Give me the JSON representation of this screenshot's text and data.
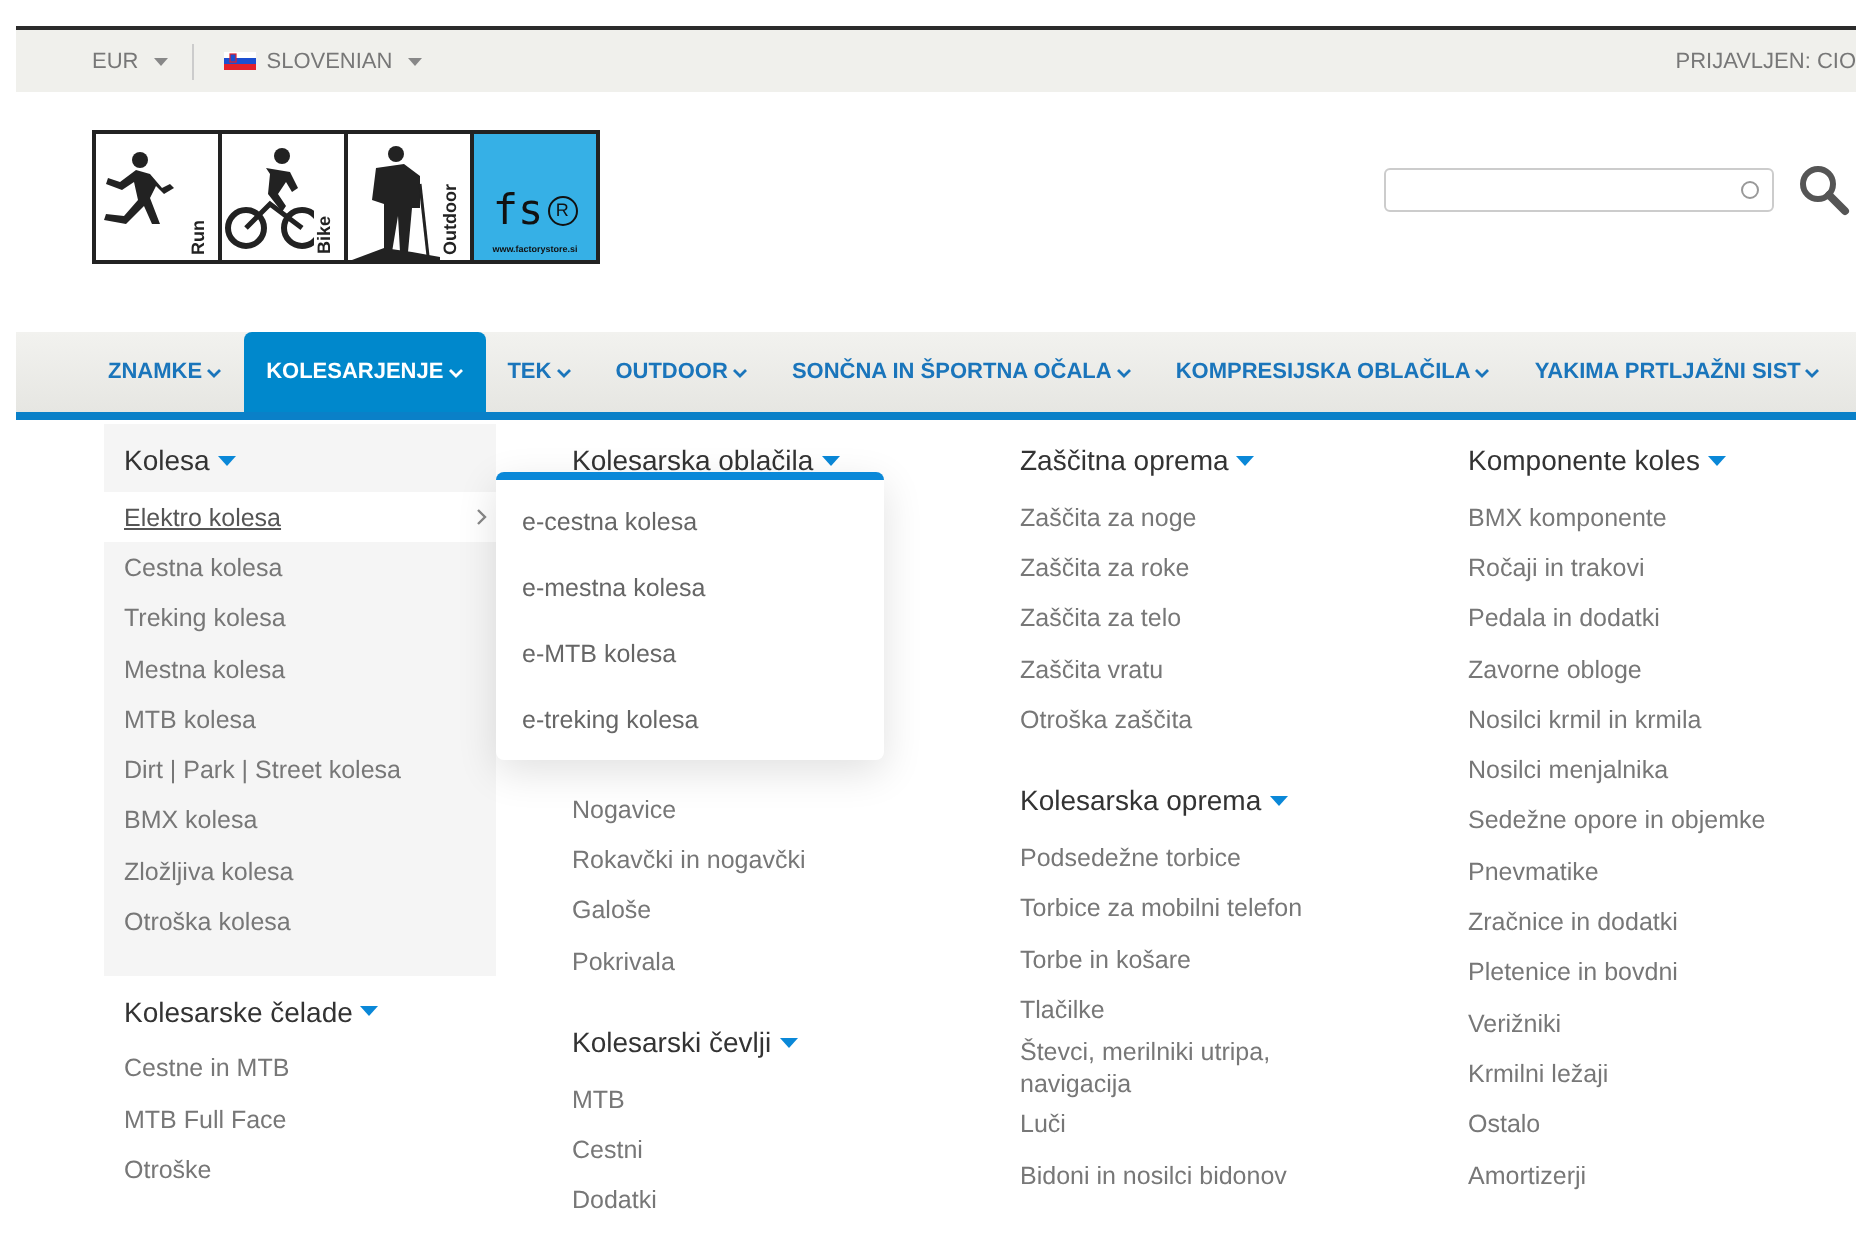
{
  "top_bar": {
    "currency": "EUR",
    "language": "SLOVENIAN",
    "login": "PRIJAVLJEN: CIO"
  },
  "logo": {
    "panels": [
      "Run",
      "Bike",
      "Outdoor"
    ],
    "mark": "fs",
    "mark_symbol": "R",
    "url": "www.factorystore.si"
  },
  "nav": [
    {
      "label": "ZNAMKE",
      "selected": false
    },
    {
      "label": "KOLESARJENJE",
      "selected": true
    },
    {
      "label": "TEK",
      "selected": false
    },
    {
      "label": "OUTDOOR",
      "selected": false
    },
    {
      "label": "SONČNA IN ŠPORTNA OČALA",
      "selected": false
    },
    {
      "label": "KOMPRESIJSKA OBLAČILA",
      "selected": false
    },
    {
      "label": "YAKIMA PRTLJAŽNI SIST",
      "selected": false
    }
  ],
  "mega_menu": {
    "columns": [
      {
        "groups": [
          {
            "heading": "Kolesa",
            "panel": true,
            "items": [
              {
                "label": "Elektro kolesa",
                "selected": true,
                "children": [
                  "e-cestna kolesa",
                  "e-mestna kolesa",
                  "e-MTB kolesa",
                  "e-treking kolesa"
                ]
              },
              {
                "label": "Cestna kolesa",
                "selected": false
              },
              {
                "label": "Treking kolesa",
                "selected": false
              },
              {
                "label": "Mestna kolesa",
                "selected": false
              },
              {
                "label": "MTB kolesa",
                "selected": false
              },
              {
                "label": "Dirt | Park | Street kolesa",
                "selected": false
              },
              {
                "label": "BMX kolesa",
                "selected": false
              },
              {
                "label": "Zložljiva kolesa",
                "selected": false
              },
              {
                "label": "Otroška kolesa",
                "selected": false
              }
            ]
          },
          {
            "heading": "Kolesarske čelade",
            "panel": false,
            "items": [
              {
                "label": "Cestne in MTB",
                "selected": false
              },
              {
                "label": "MTB Full Face",
                "selected": false
              },
              {
                "label": "Otroške",
                "selected": false
              }
            ]
          }
        ]
      },
      {
        "groups": [
          {
            "heading": "Kolesarska oblačila",
            "panel": false,
            "items": [
              {
                "label": "Nogavice",
                "selected": false
              },
              {
                "label": "Rokavčki in nogavčki",
                "selected": false
              },
              {
                "label": "Galoše",
                "selected": false
              },
              {
                "label": "Pokrivala",
                "selected": false
              }
            ]
          },
          {
            "heading": "Kolesarski čevlji",
            "panel": false,
            "items": [
              {
                "label": "MTB",
                "selected": false
              },
              {
                "label": "Cestni",
                "selected": false
              },
              {
                "label": "Dodatki",
                "selected": false
              }
            ]
          }
        ]
      },
      {
        "groups": [
          {
            "heading": "Zaščitna oprema",
            "panel": false,
            "items": [
              {
                "label": "Zaščita za noge",
                "selected": false
              },
              {
                "label": "Zaščita za roke",
                "selected": false
              },
              {
                "label": "Zaščita za telo",
                "selected": false
              },
              {
                "label": "Zaščita vratu",
                "selected": false
              },
              {
                "label": "Otroška zaščita",
                "selected": false
              }
            ]
          },
          {
            "heading": "Kolesarska oprema",
            "panel": false,
            "items": [
              {
                "label": "Podsedežne torbice",
                "selected": false
              },
              {
                "label": "Torbice za mobilni telefon",
                "selected": false
              },
              {
                "label": "Torbe in košare",
                "selected": false
              },
              {
                "label": "Tlačilke",
                "selected": false
              },
              {
                "label": "Števci, merilniki utripa, navigacija",
                "selected": false
              },
              {
                "label": "Luči",
                "selected": false
              },
              {
                "label": "Bidoni in nosilci bidonov",
                "selected": false
              }
            ]
          }
        ]
      },
      {
        "groups": [
          {
            "heading": "Komponente koles",
            "panel": false,
            "items": [
              {
                "label": "BMX komponente",
                "selected": false
              },
              {
                "label": "Ročaji in trakovi",
                "selected": false
              },
              {
                "label": "Pedala in dodatki",
                "selected": false
              },
              {
                "label": "Zavorne obloge",
                "selected": false
              },
              {
                "label": "Nosilci krmil in krmila",
                "selected": false
              },
              {
                "label": "Nosilci menjalnika",
                "selected": false
              },
              {
                "label": "Sedežne opore in objemke",
                "selected": false
              },
              {
                "label": "Pnevmatike",
                "selected": false
              },
              {
                "label": "Zračnice in dodatki",
                "selected": false
              },
              {
                "label": "Pletenice in bovdni",
                "selected": false
              },
              {
                "label": "Verižniki",
                "selected": false
              },
              {
                "label": "Krmilni ležaji",
                "selected": false
              },
              {
                "label": "Ostalo",
                "selected": false
              },
              {
                "label": "Amortizerji",
                "selected": false
              }
            ]
          }
        ]
      }
    ]
  }
}
